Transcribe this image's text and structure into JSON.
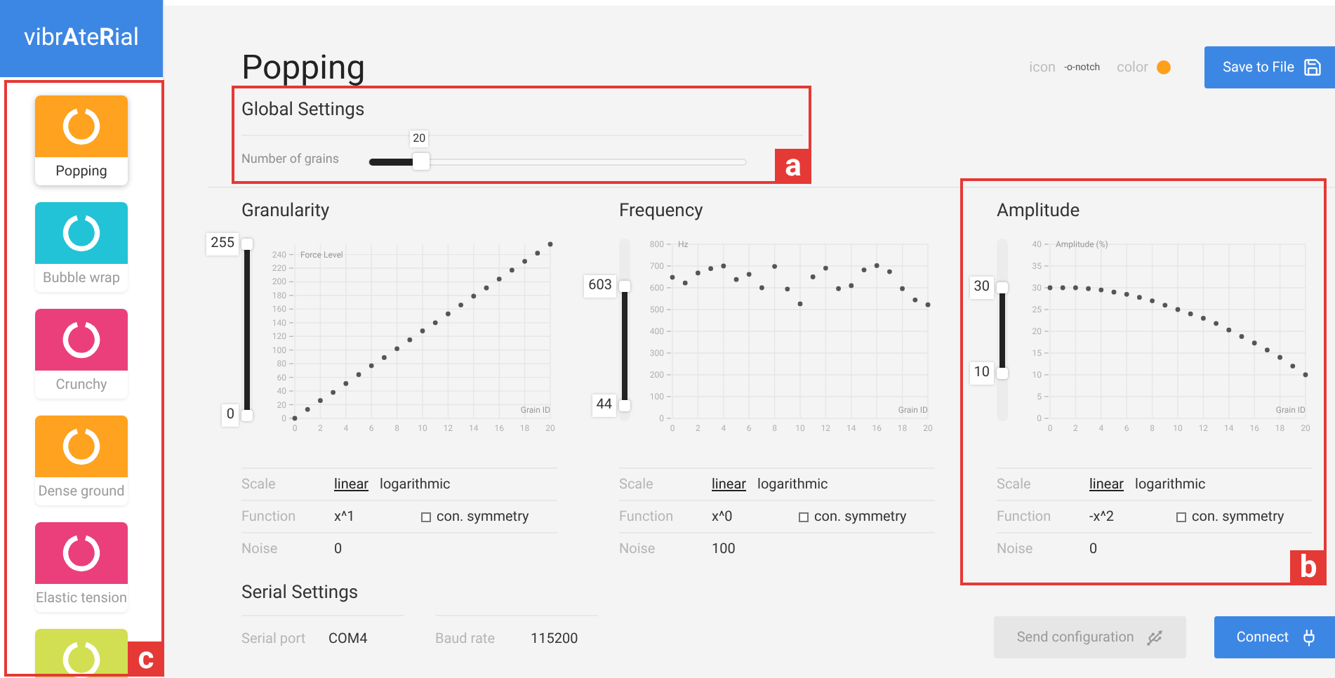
{
  "sidebar": {
    "logo": "vibr**A**te**R**ial",
    "presets": [
      {
        "label": "Popping",
        "color": "#ffa21f",
        "selected": true
      },
      {
        "label": "Bubble wrap",
        "color": "#22c3d6",
        "selected": false
      },
      {
        "label": "Crunchy",
        "color": "#ea3f7b",
        "selected": false
      },
      {
        "label": "Dense ground",
        "color": "#ffa21f",
        "selected": false
      },
      {
        "label": "Elastic tension",
        "color": "#ea3f7b",
        "selected": false
      },
      {
        "color": "#d2df52",
        "selected": false
      }
    ]
  },
  "title": "Popping",
  "meta": {
    "icon_label": "icon",
    "icon_value": "-o-notch",
    "color_label": "color",
    "color": "#ff9f1a"
  },
  "save_button": {
    "label": "Save to File"
  },
  "global_settings": {
    "title": "Global Settings",
    "grains": {
      "label": "Number of grains",
      "reading": "20",
      "level": 0.13
    }
  },
  "parameters": [
    {
      "title": "Granularity",
      "range": {
        "max": {
          "reading": "255",
          "level": 1
        },
        "min": {
          "reading": "0",
          "level": 0
        }
      },
      "chart_data": {
        "type": "scatter",
        "ylabel": "Force Level",
        "xlabel": "Grain ID",
        "x": [
          0,
          1,
          2,
          3,
          4,
          5,
          6,
          7,
          8,
          9,
          10,
          11,
          12,
          13,
          14,
          15,
          16,
          17,
          18,
          19,
          20
        ],
        "xlim": [
          0,
          20
        ],
        "ylim": [
          0,
          255
        ],
        "xticks": [
          0,
          2,
          4,
          6,
          8,
          10,
          12,
          14,
          16,
          18,
          20
        ],
        "yticks": [
          0,
          20,
          40,
          60,
          80,
          100,
          120,
          140,
          160,
          180,
          200,
          220,
          240
        ],
        "grid": true,
        "values": [
          0,
          13,
          26,
          38,
          51,
          64,
          77,
          89,
          102,
          115,
          128,
          140,
          153,
          166,
          179,
          191,
          204,
          217,
          230,
          242,
          255
        ]
      },
      "settings": {
        "scale_label": "Scale",
        "scale_options": [
          {
            "label": "linear",
            "selected": true
          },
          {
            "label": "logarithmic",
            "selected": false
          }
        ],
        "function_label": "Function",
        "function": "x^1",
        "symmetry": {
          "label": "con. symmetry",
          "checked": false
        },
        "noise_label": "Noise",
        "noise": "0"
      }
    },
    {
      "title": "Frequency",
      "range": {
        "max": {
          "reading": "603",
          "level": 0.754
        },
        "min": {
          "reading": "44",
          "level": 0.055
        }
      },
      "chart_data": {
        "type": "scatter",
        "ylabel": "Hz",
        "xlabel": "Grain ID",
        "x": [
          0,
          1,
          2,
          3,
          4,
          5,
          6,
          7,
          8,
          9,
          10,
          11,
          12,
          13,
          14,
          15,
          16,
          17,
          18,
          19,
          20
        ],
        "xlim": [
          0,
          20
        ],
        "ylim": [
          0,
          800
        ],
        "xticks": [
          0,
          2,
          4,
          6,
          8,
          10,
          12,
          14,
          16,
          18,
          20
        ],
        "yticks": [
          0,
          100,
          200,
          300,
          400,
          500,
          600,
          700,
          800
        ],
        "grid": true,
        "values": [
          648,
          622,
          668,
          688,
          700,
          638,
          662,
          600,
          698,
          594,
          526,
          650,
          690,
          596,
          610,
          682,
          702,
          674,
          596,
          544,
          522
        ]
      },
      "settings": {
        "scale_label": "Scale",
        "scale_options": [
          {
            "label": "linear",
            "selected": true
          },
          {
            "label": "logarithmic",
            "selected": false
          }
        ],
        "function_label": "Function",
        "function": "x^0",
        "symmetry": {
          "label": "con. symmetry",
          "checked": false
        },
        "noise_label": "Noise",
        "noise": "100"
      }
    },
    {
      "title": "Amplitude",
      "range": {
        "max": {
          "reading": "30",
          "level": 0.75
        },
        "min": {
          "reading": "10",
          "level": 0.25
        }
      },
      "chart_data": {
        "type": "scatter",
        "ylabel": "Amplitude (%)",
        "xlabel": "Grain ID",
        "x": [
          0,
          1,
          2,
          3,
          4,
          5,
          6,
          7,
          8,
          9,
          10,
          11,
          12,
          13,
          14,
          15,
          16,
          17,
          18,
          19,
          20
        ],
        "xlim": [
          0,
          20
        ],
        "ylim": [
          0,
          40
        ],
        "xticks": [
          0,
          2,
          4,
          6,
          8,
          10,
          12,
          14,
          16,
          18,
          20
        ],
        "yticks": [
          0,
          5,
          10,
          15,
          20,
          25,
          30,
          35,
          40
        ],
        "grid": true,
        "values": [
          30,
          30,
          30,
          29.8,
          29.5,
          29,
          28.5,
          27.8,
          27,
          26,
          25,
          24,
          23,
          21.8,
          20.3,
          18.8,
          17.3,
          15.7,
          14,
          12,
          10
        ]
      },
      "settings": {
        "scale_label": "Scale",
        "scale_options": [
          {
            "label": "linear",
            "selected": true
          },
          {
            "label": "logarithmic",
            "selected": false
          }
        ],
        "function_label": "Function",
        "function": "-x^2",
        "symmetry": {
          "label": "con. symmetry",
          "checked": false
        },
        "noise_label": "Noise",
        "noise": "0"
      }
    }
  ],
  "serial_settings": {
    "title": "Serial Settings",
    "port_label": "Serial port",
    "port": "COM4",
    "baud_label": "Baud rate",
    "baud": "115200"
  },
  "buttons": [
    {
      "label": "Send configuration",
      "disabled": true,
      "kind": "usb"
    },
    {
      "label": "Connect",
      "disabled": false,
      "kind": "plug"
    }
  ],
  "annotations": [
    {
      "label": "a"
    },
    {
      "label": "b"
    },
    {
      "label": "c"
    }
  ]
}
